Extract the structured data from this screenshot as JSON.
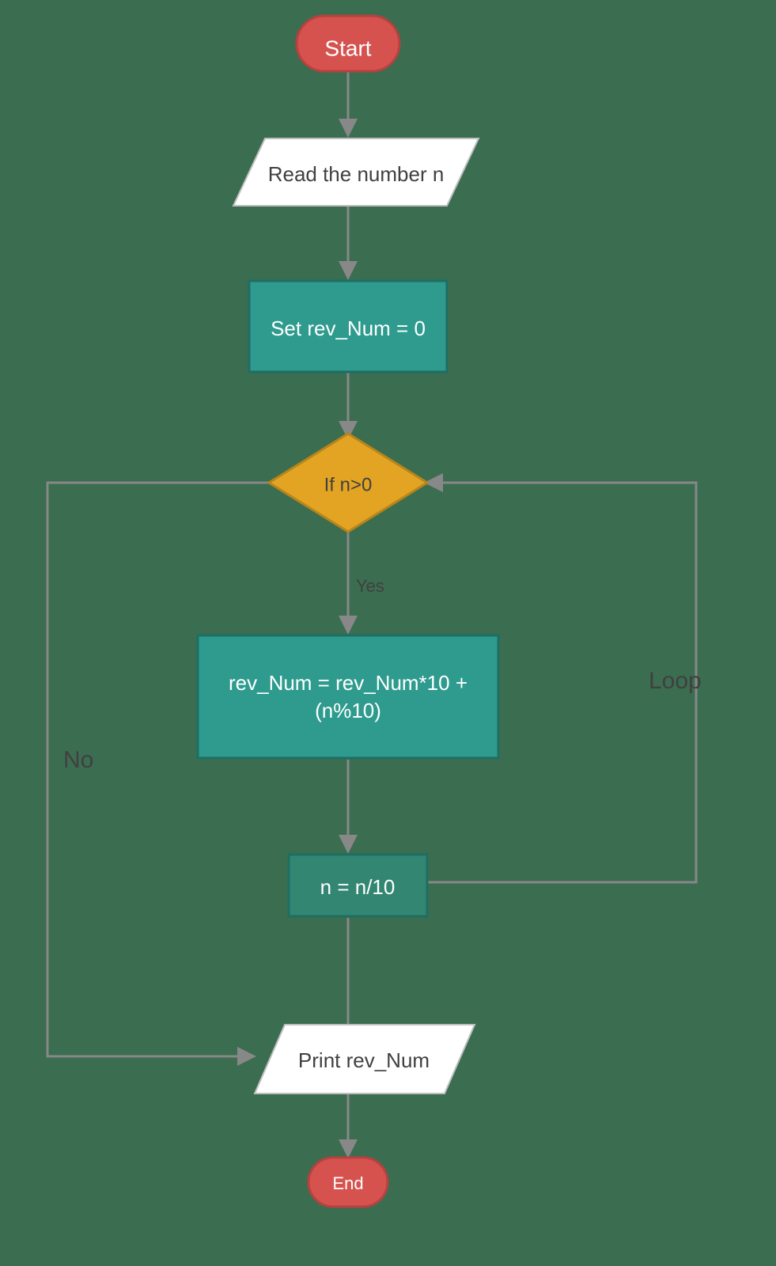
{
  "nodes": {
    "start": {
      "label": "Start"
    },
    "read": {
      "label": "Read the number n"
    },
    "init": {
      "label": "Set rev_Num = 0"
    },
    "decision": {
      "label": "If n>0"
    },
    "calc": {
      "line1": "rev_Num = rev_Num*10 +",
      "line2": "(n%10)"
    },
    "divide": {
      "label": "n = n/10"
    },
    "print": {
      "label": "Print rev_Num"
    },
    "end": {
      "label": "End"
    }
  },
  "edges": {
    "yes": "Yes",
    "no": "No",
    "loop": "Loop"
  }
}
